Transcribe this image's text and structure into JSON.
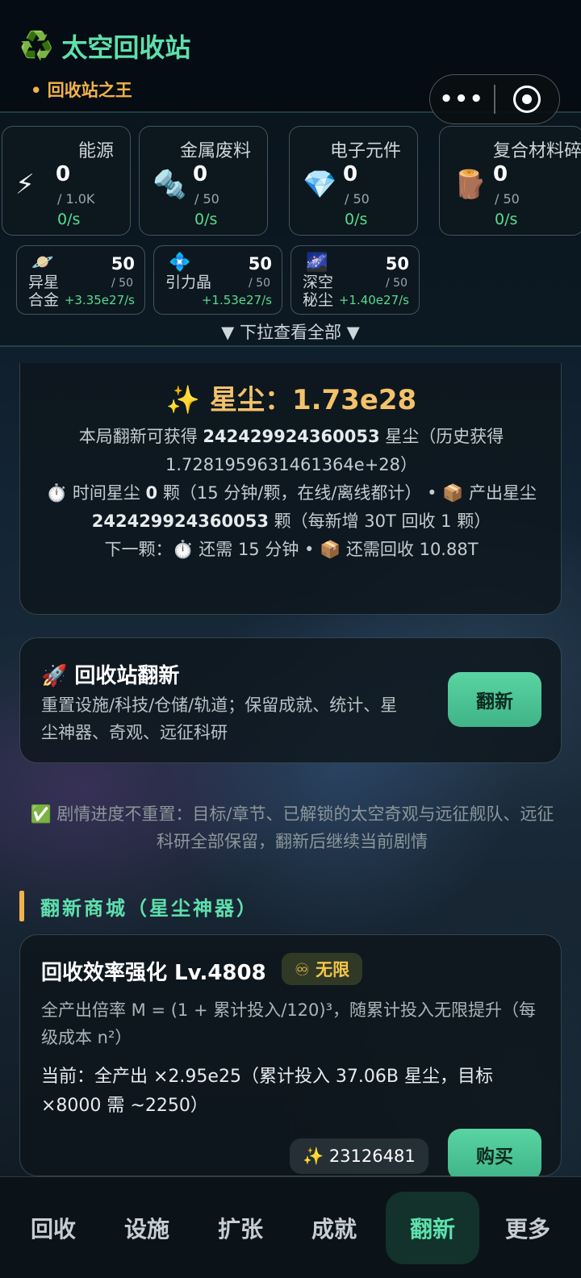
{
  "header": {
    "logo_icon": "♻️",
    "title": "太空回收站",
    "subtitle": "• 回收站之王",
    "capsule_more": "•••"
  },
  "resources": [
    {
      "name": "能源",
      "icon": "⚡",
      "value": "0",
      "cap": "/ 1.0K",
      "rate": "0/s"
    },
    {
      "name": "金属废料",
      "icon": "🔩",
      "value": "0",
      "cap": "/ 50",
      "rate": "0/s"
    },
    {
      "name": "电子元件",
      "icon": "💎",
      "value": "0",
      "cap": "/ 50",
      "rate": "0/s"
    },
    {
      "name": "复合材料碎",
      "icon": "🪵",
      "value": "0",
      "cap": "/ 50",
      "rate": "0/s"
    }
  ],
  "special_resources": [
    {
      "name": "异星合金",
      "icon": "🪐",
      "value": "50",
      "cap": "/ 50",
      "rate": "+3.35e27/s"
    },
    {
      "name": "引力晶",
      "icon": "💠",
      "value": "50",
      "cap": "/ 50",
      "rate": "+1.53e27/s"
    },
    {
      "name": "深空秘尘",
      "icon": "🌌",
      "value": "50",
      "cap": "/ 50",
      "rate": "+1.40e27/s"
    }
  ],
  "pull_hint": "▼ 下拉查看全部 ▼",
  "stardust": {
    "title": "✨ 星尘：1.73e28",
    "line1_pre": "本局翻新可获得 ",
    "line1_num": "242429924360053",
    "line1_post": " 星尘（历史获得 1.7281959631461364e+28）",
    "line2_pre": "⏱️ 时间星尘 ",
    "line2_num": "0",
    "line2_mid": " 颗（15 分钟/颗，在线/离线都计） • 📦 产出星尘 ",
    "line2_num2": "242429924360053",
    "line2_post": " 颗（每新增 30T 回收 1 颗）",
    "line3": "下一颗：⏱️ 还需 15 分钟 • 📦 还需回收 10.88T"
  },
  "refresh": {
    "title": "🚀 回收站翻新",
    "desc": "重置设施/科技/仓储/轨道；保留成就、统计、星尘神器、奇观、远征科研",
    "button": "翻新"
  },
  "note": "✅ 剧情进度不重置：目标/章节、已解锁的太空奇观与远征舰队、远征科研全部保留，翻新后继续当前剧情",
  "shop": {
    "section_title": "翻新商城（星尘神器）",
    "item_title": "回收效率强化 Lv.4808",
    "badge": "♾ 无限",
    "desc": "全产出倍率 M = (1 + 累计投入/120)³，随累计投入无限提升（每级成本 n²）",
    "current": "当前：全产出 ×2.95e25（累计投入 37.06B 星尘，目标 ×8000 需 ~2250）",
    "cost": "✨ 23126481",
    "buy": "购买"
  },
  "nav": {
    "tabs": [
      "回收",
      "设施",
      "扩张",
      "成就",
      "翻新",
      "更多"
    ],
    "active": "翻新"
  }
}
